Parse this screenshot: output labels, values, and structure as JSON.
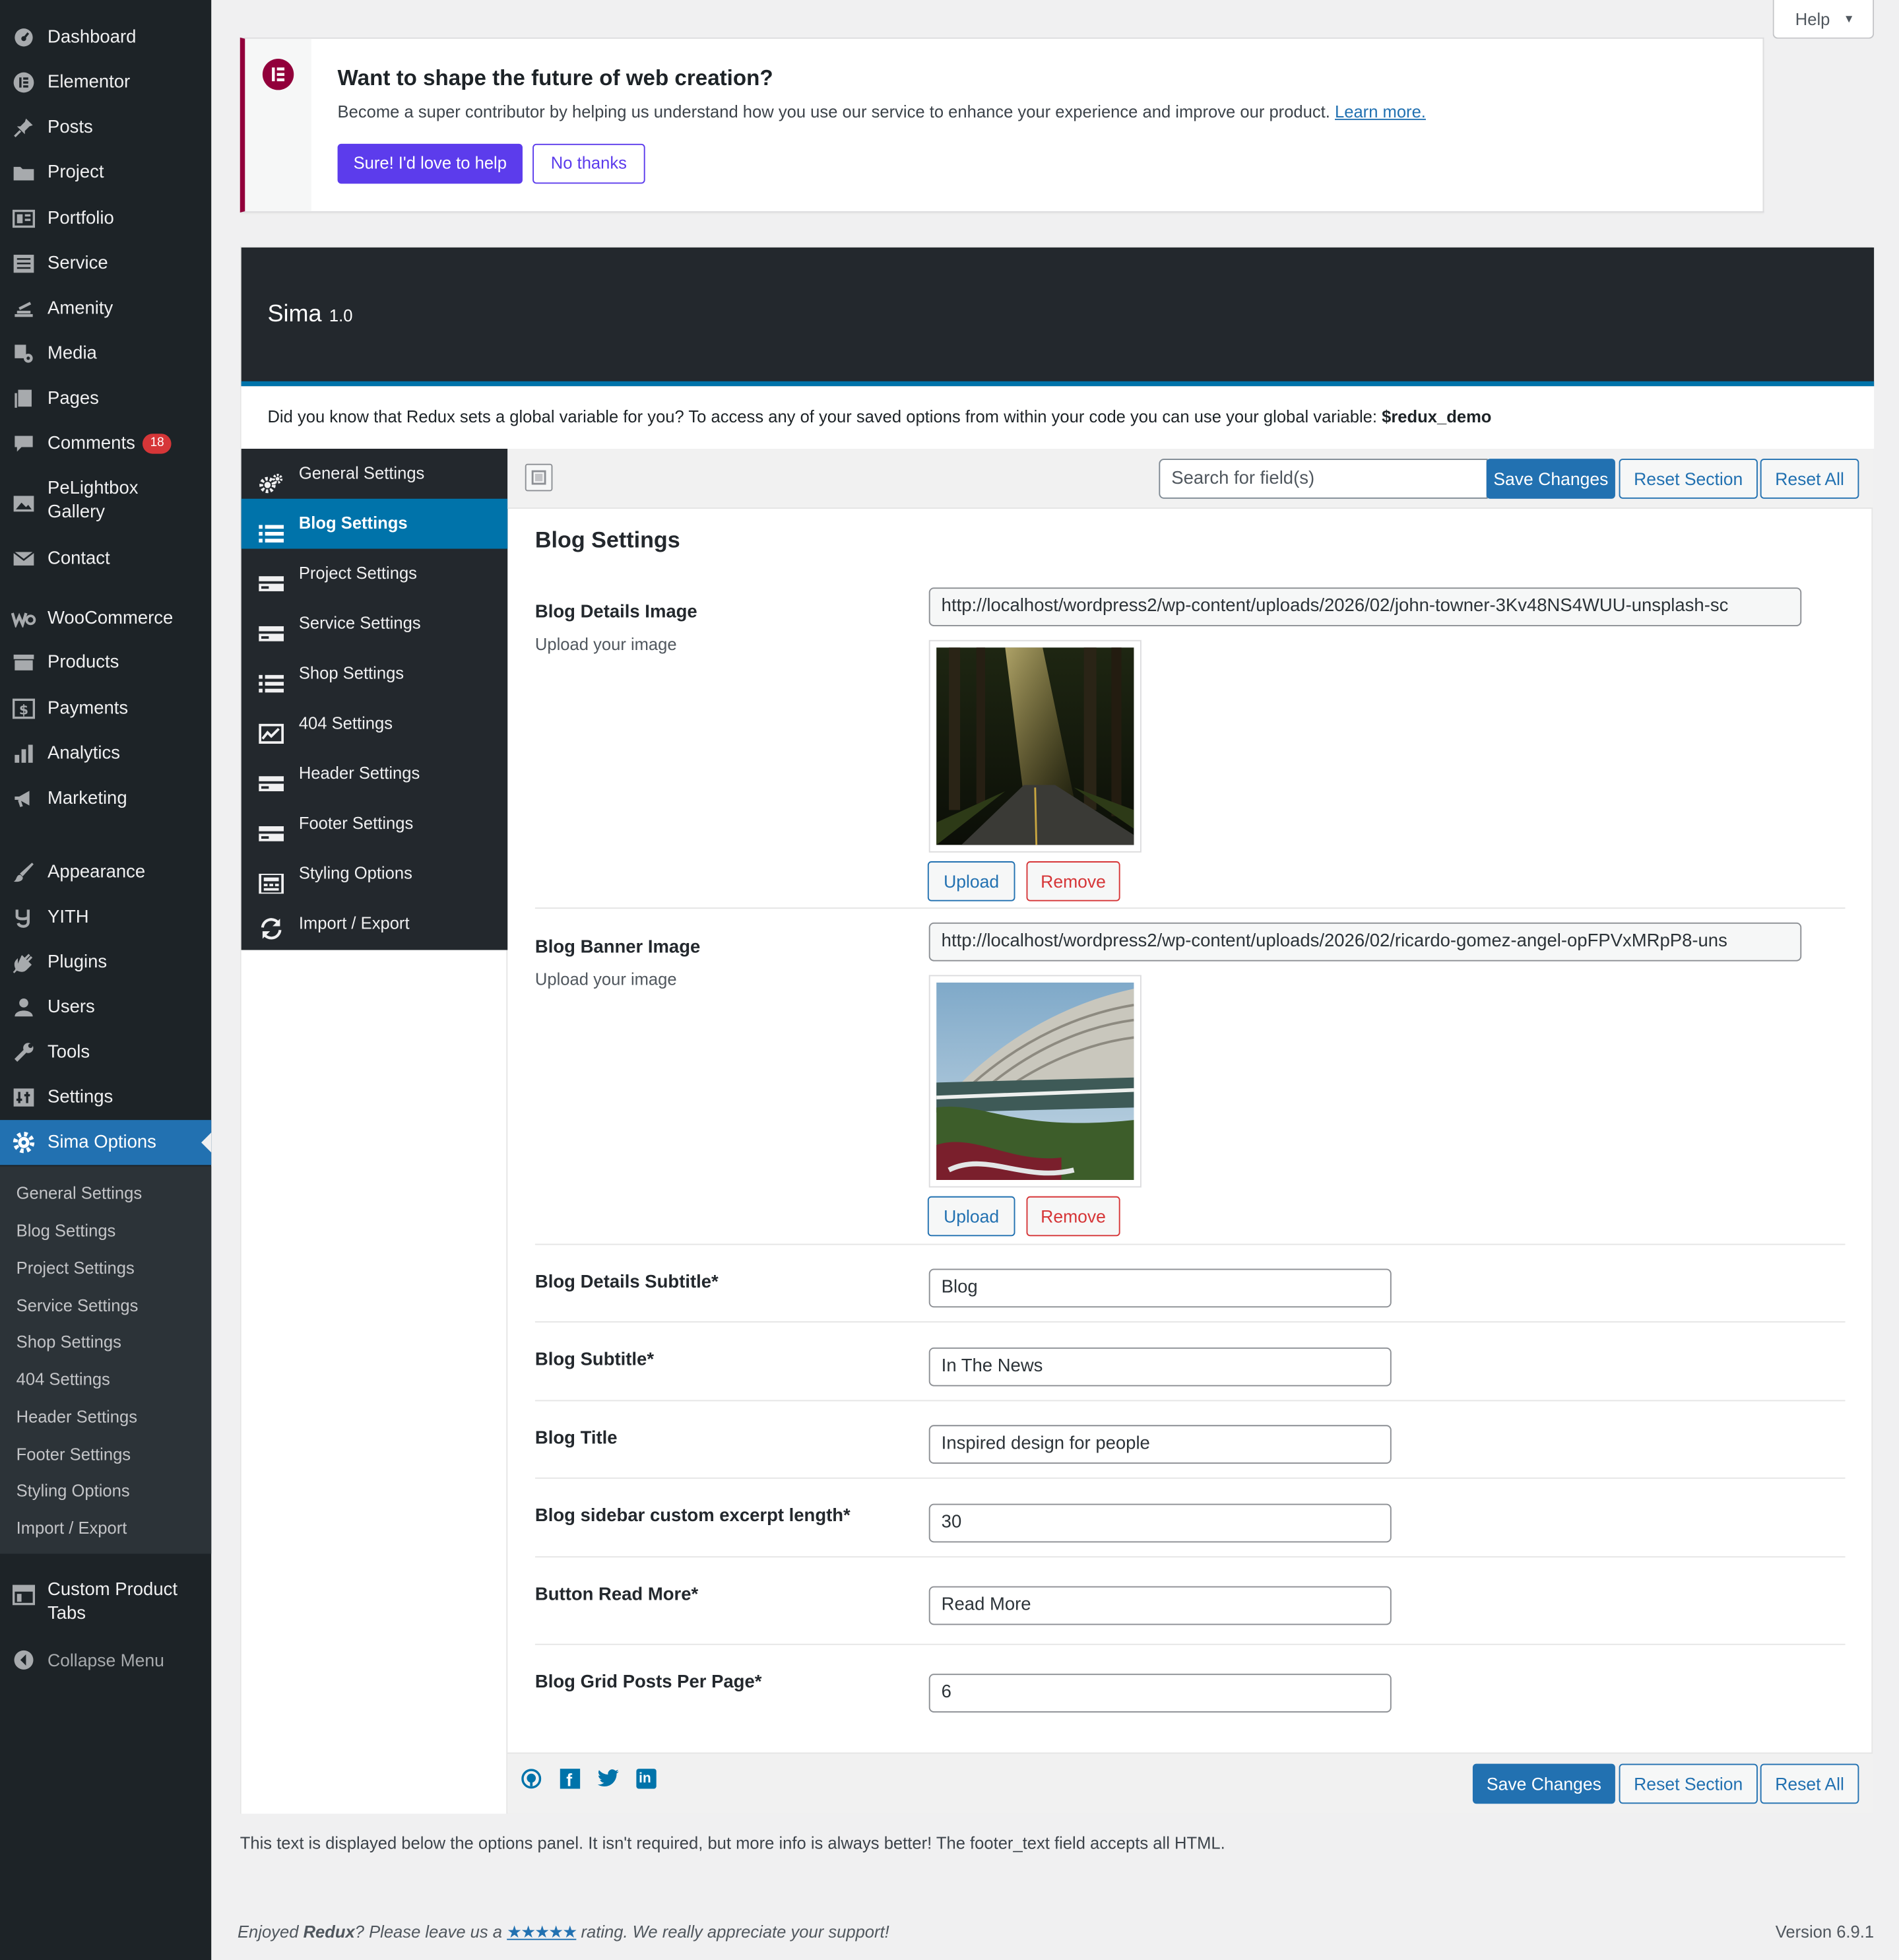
{
  "admin_menu": {
    "items": [
      {
        "label": "Dashboard",
        "icon": "dashboard-icon"
      },
      {
        "label": "Elementor",
        "icon": "elementor-icon"
      },
      {
        "label": "Posts",
        "icon": "pin-icon"
      },
      {
        "label": "Project",
        "icon": "folder-icon"
      },
      {
        "label": "Portfolio",
        "icon": "portfolio-icon"
      },
      {
        "label": "Service",
        "icon": "list-icon"
      },
      {
        "label": "Amenity",
        "icon": "amenity-icon"
      },
      {
        "label": "Media",
        "icon": "media-icon"
      },
      {
        "label": "Pages",
        "icon": "pages-icon"
      },
      {
        "label": "Comments",
        "icon": "comment-icon",
        "badge": "18"
      },
      {
        "label": "PeLightbox Gallery",
        "icon": "gallery-icon"
      },
      {
        "label": "Contact",
        "icon": "mail-icon"
      },
      {
        "label": "WooCommerce",
        "icon": "woocommerce-icon"
      },
      {
        "label": "Products",
        "icon": "products-icon"
      },
      {
        "label": "Payments",
        "icon": "payments-icon"
      },
      {
        "label": "Analytics",
        "icon": "bar-chart-icon"
      },
      {
        "label": "Marketing",
        "icon": "megaphone-icon"
      },
      {
        "label": "Appearance",
        "icon": "brush-icon"
      },
      {
        "label": "YITH",
        "icon": "yith-icon"
      },
      {
        "label": "Plugins",
        "icon": "plugin-icon"
      },
      {
        "label": "Users",
        "icon": "user-icon"
      },
      {
        "label": "Tools",
        "icon": "wrench-icon"
      },
      {
        "label": "Settings",
        "icon": "settings-icon"
      },
      {
        "label": "Sima Options",
        "icon": "gear-icon"
      }
    ],
    "submenu": [
      "General Settings",
      "Blog Settings",
      "Project Settings",
      "Service Settings",
      "Shop Settings",
      "404 Settings",
      "Header Settings",
      "Footer Settings",
      "Styling Options",
      "Import / Export"
    ],
    "custom_tabs": "Custom Product Tabs",
    "collapse": "Collapse Menu"
  },
  "help_label": "Help",
  "notice": {
    "title": "Want to shape the future of web creation?",
    "text": "Become a super contributor by helping us understand how you use our service to enhance your experience and improve our product.",
    "link": "Learn more.",
    "accept": "Sure! I'd love to help",
    "decline": "No thanks"
  },
  "redux": {
    "title": "Sima",
    "version": "1.0",
    "notice": "Did you know that Redux sets a global variable for you? To access any of your saved options from within your code you can use your global variable:",
    "notice_var": "$redux_demo",
    "menu": [
      {
        "label": "General Settings",
        "icon": "cogs-icon"
      },
      {
        "label": "Blog Settings",
        "icon": "list-icon"
      },
      {
        "label": "Project Settings",
        "icon": "card-icon"
      },
      {
        "label": "Service Settings",
        "icon": "card-icon"
      },
      {
        "label": "Shop Settings",
        "icon": "list-icon"
      },
      {
        "label": "404 Settings",
        "icon": "chart-icon"
      },
      {
        "label": "Header Settings",
        "icon": "card-icon"
      },
      {
        "label": "Footer Settings",
        "icon": "card-icon"
      },
      {
        "label": "Styling Options",
        "icon": "layout-icon"
      },
      {
        "label": "Import / Export",
        "icon": "refresh-icon"
      }
    ],
    "search_placeholder": "Search for field(s)",
    "save": "Save Changes",
    "reset_section": "Reset Section",
    "reset_all": "Reset All",
    "section_title": "Blog Settings",
    "fields": {
      "details_image": {
        "label": "Blog Details Image",
        "sub": "Upload your image",
        "value": "http://localhost/wordpress2/wp-content/uploads/2026/02/john-towner-3Kv48NS4WUU-unsplash-sc"
      },
      "banner_image": {
        "label": "Blog Banner Image",
        "sub": "Upload your image",
        "value": "http://localhost/wordpress2/wp-content/uploads/2026/02/ricardo-gomez-angel-opFPVxMRpP8-uns"
      },
      "upload": "Upload",
      "remove": "Remove",
      "details_subtitle": {
        "label": "Blog Details Subtitle*",
        "value": "Blog"
      },
      "blog_subtitle": {
        "label": "Blog Subtitle*",
        "value": "In The News"
      },
      "blog_title": {
        "label": "Blog Title",
        "value": "Inspired design for people"
      },
      "excerpt_length": {
        "label": "Blog sidebar custom excerpt length*",
        "value": "30"
      },
      "read_more": {
        "label": "Button Read More*",
        "value": "Read More"
      },
      "grid_posts": {
        "label": "Blog Grid Posts Per Page*",
        "value": "6"
      }
    },
    "social_icons": [
      "github-icon",
      "facebook-icon",
      "twitter-icon",
      "linkedin-icon"
    ]
  },
  "below_text": "This text is displayed below the options panel. It isn't required, but more info is always better! The footer_text field accepts all HTML.",
  "footer": {
    "enjoyed_pre": "Enjoyed",
    "enjoyed_brand": "Redux",
    "enjoyed_mid": "? Please leave us a",
    "stars": "★★★★★",
    "enjoyed_post": "rating. We really appreciate your support!",
    "version": "Version 6.9.1"
  },
  "colors": {
    "admin_bg": "#1d2327",
    "accent": "#2271b1",
    "elementor": "#92003b",
    "elementor_btn": "#5c3cec",
    "redux_accent": "#0073aa",
    "badge": "#d63638"
  }
}
